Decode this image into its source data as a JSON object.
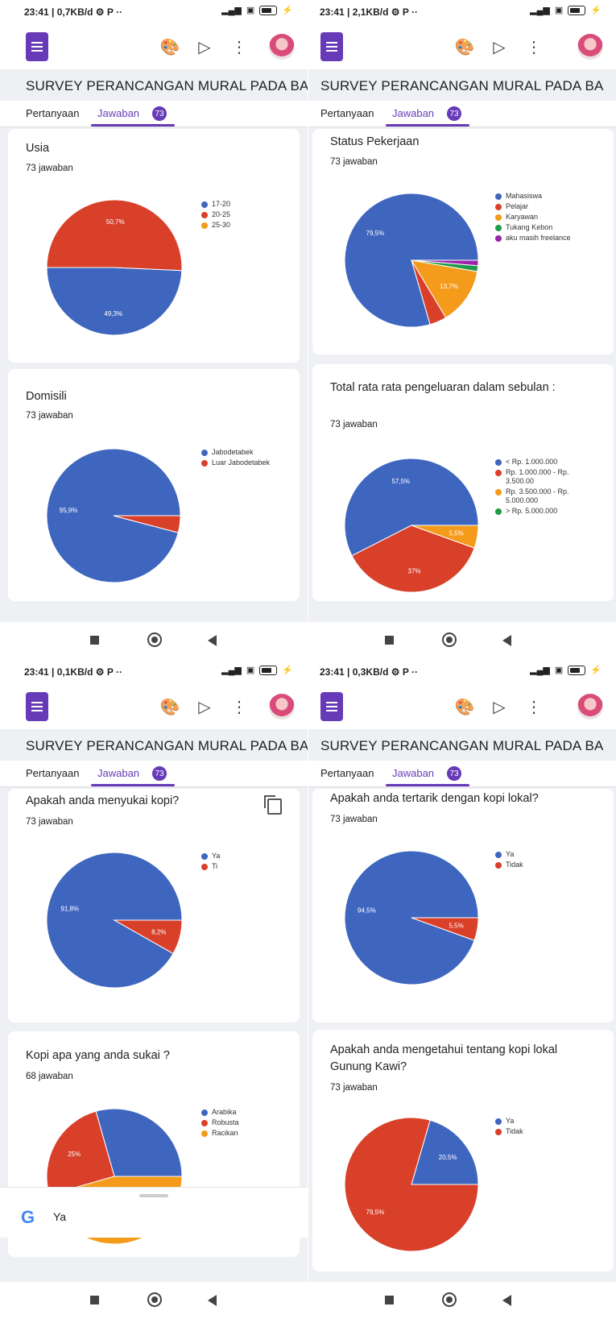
{
  "screens": [
    {
      "status": {
        "time": "23:41 | 0,7KB/d ⚙ P ··",
        "battery": "39"
      },
      "header": {
        "title": "SURVEY PERANCANGAN MURAL PADA BA"
      },
      "tabs": {
        "questions": "Pertanyaan",
        "responses": "Jawaban",
        "count": "73"
      },
      "cards": [
        {
          "title": "Usia",
          "count": "73 jawaban",
          "chart_data": {
            "type": "pie",
            "labels": [
              "17-20",
              "20-25",
              "25-30"
            ],
            "values": [
              49.3,
              50.7,
              0
            ],
            "value_labels": [
              "49,3%",
              "50,7%",
              ""
            ],
            "colors": [
              "#3f66bf",
              "#d9402a",
              "#f59b1b"
            ]
          }
        },
        {
          "title": "Domisili",
          "count": "73 jawaban",
          "chart_data": {
            "type": "pie",
            "labels": [
              "Jabodetabek",
              "Luar Jabodetabek"
            ],
            "values": [
              95.9,
              4.1
            ],
            "value_labels": [
              "95,9%",
              ""
            ],
            "colors": [
              "#3f66bf",
              "#d9402a"
            ]
          }
        }
      ]
    },
    {
      "status": {
        "time": "23:41 | 2,1KB/d ⚙ P ··",
        "battery": "39"
      },
      "header": {
        "title": "SURVEY PERANCANGAN MURAL PADA BA"
      },
      "tabs": {
        "questions": "Pertanyaan",
        "responses": "Jawaban",
        "count": "73"
      },
      "cards": [
        {
          "title": "Status Pekerjaan",
          "count": "73 jawaban",
          "chart_data": {
            "type": "pie",
            "labels": [
              "Mahasiswa",
              "Pelajar",
              "Karyawan",
              "Tukang Kebon",
              "aku masih freelance"
            ],
            "values": [
              79.5,
              4.1,
              13.7,
              1.4,
              1.3
            ],
            "value_labels": [
              "79,5%",
              "",
              "13,7%",
              "",
              ""
            ],
            "colors": [
              "#3f66bf",
              "#d9402a",
              "#f59b1b",
              "#1f9a46",
              "#9b24ab"
            ]
          }
        },
        {
          "title": "Total rata  rata pengeluaran dalam sebulan :",
          "count": "73 jawaban",
          "chart_data": {
            "type": "pie",
            "labels": [
              "< Rp. 1.000.000",
              "Rp. 1.000.000 - Rp. 3.500.00",
              "Rp. 3.500.000 - Rp. 5.000.000",
              "> Rp. 5.000.000"
            ],
            "values": [
              57.5,
              37,
              5.5,
              0
            ],
            "value_labels": [
              "57,5%",
              "37%",
              "5,5%",
              ""
            ],
            "colors": [
              "#3f66bf",
              "#d9402a",
              "#f59b1b",
              "#1f9a46"
            ]
          }
        }
      ]
    },
    {
      "status": {
        "time": "23:41 | 0,1KB/d ⚙ P ··",
        "battery": "39"
      },
      "header": {
        "title": "SURVEY PERANCANGAN MURAL PADA BA"
      },
      "tabs": {
        "questions": "Pertanyaan",
        "responses": "Jawaban",
        "count": "73"
      },
      "cards": [
        {
          "title": "Apakah anda menyukai kopi?",
          "count": "73 jawaban",
          "chart_data": {
            "type": "pie",
            "labels": [
              "Ya",
              "Ti"
            ],
            "values": [
              91.8,
              8.2
            ],
            "value_labels": [
              "91,8%",
              "8,2%"
            ],
            "colors": [
              "#3f66bf",
              "#d9402a"
            ]
          }
        },
        {
          "title": "Kopi apa yang anda sukai ?",
          "count": "68 jawaban",
          "chart_data": {
            "type": "pie",
            "labels": [
              "Arabika",
              "Robusta",
              "Racikan"
            ],
            "values": [
              29.4,
              25,
              45.6
            ],
            "value_labels": [
              "",
              "25%",
              "45,6%"
            ],
            "colors": [
              "#3f66bf",
              "#d9402a",
              "#f59b1b"
            ]
          }
        }
      ],
      "google_bar": {
        "logo": "G",
        "text": "Ya"
      }
    },
    {
      "status": {
        "time": "23:41 | 0,3KB/d ⚙ P ··",
        "battery": "39"
      },
      "header": {
        "title": "SURVEY PERANCANGAN MURAL PADA BA"
      },
      "tabs": {
        "questions": "Pertanyaan",
        "responses": "Jawaban",
        "count": "73"
      },
      "cards": [
        {
          "title": "Apakah anda tertarik dengan kopi lokal?",
          "count": "73 jawaban",
          "chart_data": {
            "type": "pie",
            "labels": [
              "Ya",
              "Tidak"
            ],
            "values": [
              94.5,
              5.5
            ],
            "value_labels": [
              "94,5%",
              "5,5%"
            ],
            "colors": [
              "#3f66bf",
              "#d9402a"
            ]
          }
        },
        {
          "title": "Apakah anda mengetahui tentang kopi lokal Gunung Kawi?",
          "count": "73 jawaban",
          "chart_data": {
            "type": "pie",
            "labels": [
              "Ya",
              "Tidak"
            ],
            "values": [
              20.5,
              79.5
            ],
            "value_labels": [
              "20,5%",
              "79,5%"
            ],
            "colors": [
              "#3f66bf",
              "#d9402a"
            ]
          }
        }
      ]
    }
  ]
}
